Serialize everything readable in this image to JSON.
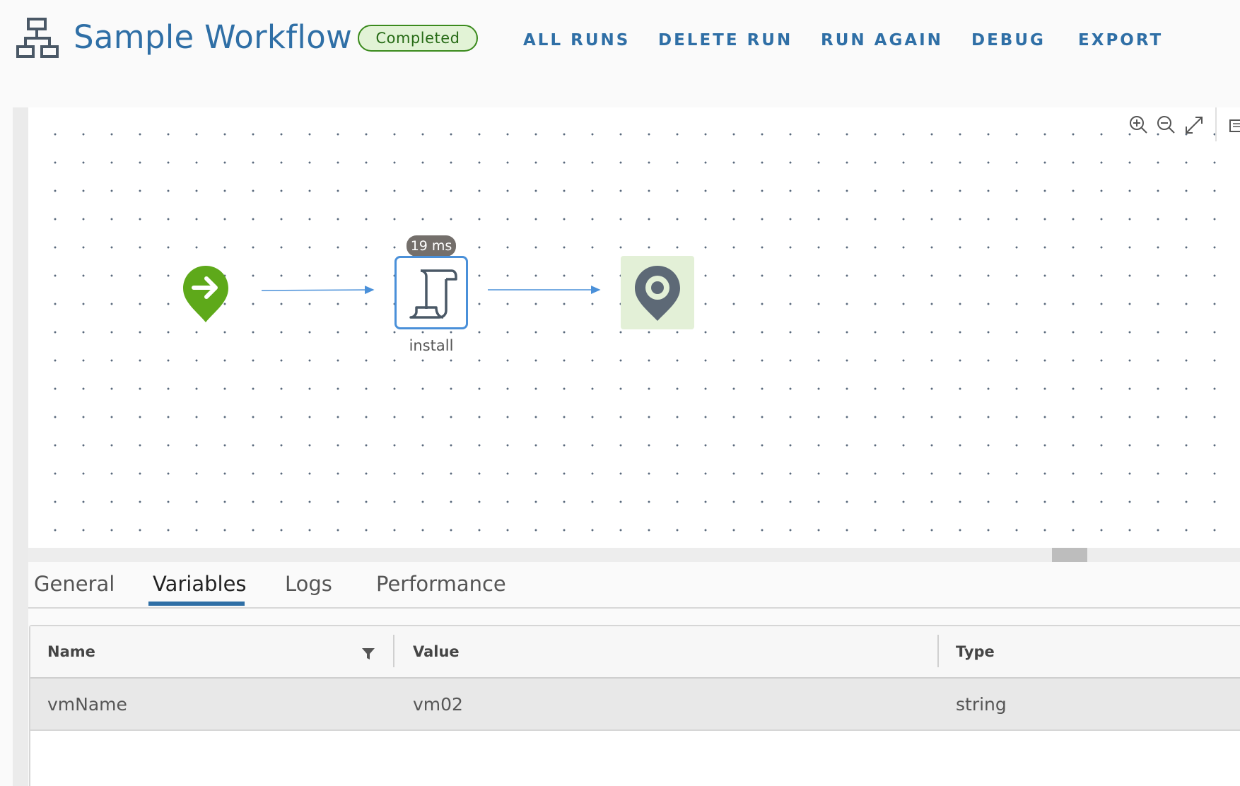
{
  "header": {
    "title": "Sample Workflow",
    "status": "Completed",
    "actions": [
      "ALL RUNS",
      "DELETE RUN",
      "RUN AGAIN",
      "DEBUG",
      "EXPORT"
    ]
  },
  "canvas": {
    "toolbar": [
      "zoom-in-icon",
      "zoom-out-icon",
      "fit-to-screen-icon",
      "minimap-icon"
    ],
    "nodes": {
      "start": {
        "icon": "arrow-right-pin-icon",
        "color": "#5ea91a"
      },
      "task": {
        "label": "install",
        "duration": "19 ms",
        "icon": "script-scroll-icon",
        "border_color": "#4a90d9"
      },
      "end": {
        "icon": "location-pin-icon",
        "background": "#e3f0d7"
      }
    },
    "edge_color": "#4a90d9"
  },
  "tabs": {
    "items": [
      "General",
      "Variables",
      "Logs",
      "Performance"
    ],
    "active": "Variables"
  },
  "variables_table": {
    "columns": [
      "Name",
      "Value",
      "Type"
    ],
    "rows": [
      {
        "name": "vmName",
        "value": "vm02",
        "type": "string"
      }
    ]
  },
  "colors": {
    "accent": "#2f6fa6",
    "status_green": "#3a8a1c"
  }
}
